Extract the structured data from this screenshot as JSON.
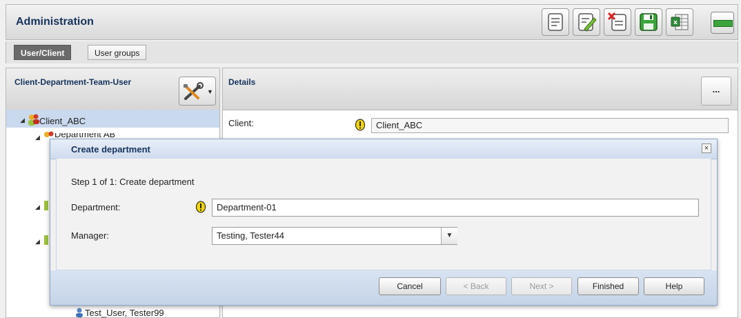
{
  "header": {
    "title": "Administration",
    "toolbar_icons": [
      "note-icon",
      "edit-note-icon",
      "delete-note-icon",
      "save-icon",
      "excel-export-icon",
      "minimize-icon"
    ]
  },
  "tabs": [
    {
      "label": "User/Client",
      "active": true
    },
    {
      "label": "User groups",
      "active": false
    }
  ],
  "left_panel": {
    "title": "Client-Department-Team-User",
    "tree": {
      "client": "Client_ABC",
      "department_partial": "Department AB",
      "user": "Test_User, Tester99"
    }
  },
  "right_panel": {
    "title": "Details",
    "more_label": "...",
    "client_label": "Client:",
    "client_value": "Client_ABC"
  },
  "dialog": {
    "title": "Create department",
    "close_label": "×",
    "step_text": "Step 1 of 1: Create department",
    "department_label": "Department:",
    "department_value": "Department-01",
    "manager_label": "Manager:",
    "manager_value": "Testing, Tester44",
    "buttons": {
      "cancel": "Cancel",
      "back": "< Back",
      "next": "Next >",
      "finished": "Finished",
      "help": "Help"
    }
  },
  "colors": {
    "title_text": "#15325c",
    "tree_selection": "#c9d9ee",
    "warning": "#f2d600"
  }
}
